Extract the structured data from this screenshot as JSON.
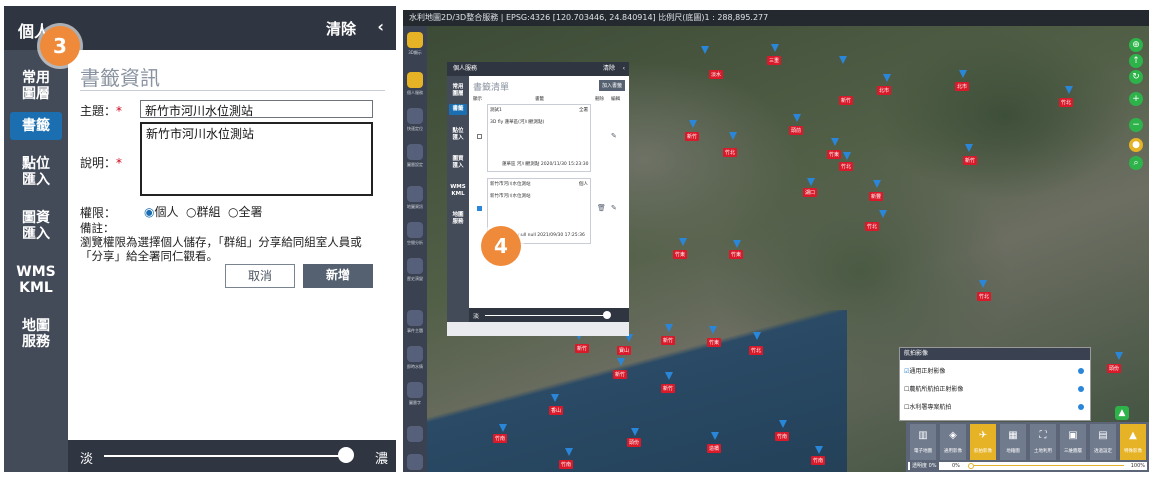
{
  "left": {
    "header": {
      "title": "個人",
      "clear": "清除",
      "chevron": "‹"
    },
    "sidebar": [
      {
        "label": "常用\n圖層"
      },
      {
        "label": "書籤"
      },
      {
        "label": "點位\n匯入"
      },
      {
        "label": "圖資\n匯入"
      },
      {
        "label": "WMS\nKML"
      },
      {
        "label": "地圖\n服務"
      }
    ],
    "form": {
      "heading": "書籤資訊",
      "subject_label": "主題：",
      "required_mark": "*",
      "subject_value": "新竹市河川水位測站",
      "desc_label": "說明：",
      "desc_value": "新竹市河川水位測站",
      "perm_label": "權限：",
      "perm_options": [
        "個人",
        "群組",
        "全署"
      ],
      "note_title": "備註：",
      "note_line1": "瀏覽權限為選擇個人儲存，「群組」分享給同組室人員或",
      "note_line2": "「分享」給全署同仁觀看。",
      "cancel": "取消",
      "add": "新增"
    },
    "footer": {
      "faint": "淡",
      "dense": "濃"
    },
    "badge": "3"
  },
  "right": {
    "topbar": "水利地圖2D/3D整合服務 | EPSG:4326 [120.703446, 24.840914] 比例尺(底圖)1 : 288,895.277",
    "sidebar_labels": [
      "3D顯示",
      "",
      "個人服務",
      "快速定位",
      "圖層設定",
      "地圖資訊",
      "空間分析",
      "歷史演變",
      "事件主題",
      "即時水情",
      "圖層字",
      ""
    ],
    "panel": {
      "title": "個人服務",
      "clear": "清除",
      "tabs": [
        "常用\n圖層",
        "書籤",
        "點位\n匯入",
        "圖資\n匯入",
        "WMS\nKML",
        "地圖\n服務"
      ],
      "heading": "書籤清單",
      "add_btn": "加入書籤",
      "cols": [
        "顯示",
        "書籤",
        "刪除",
        "編輯"
      ],
      "group_label": "測試1",
      "group_scope": "全署",
      "item1": "3D fly 蓮華區(河川觀測點)",
      "item1_meta": "蓮華區 河川觀測點 2020/11/30 15:23:30",
      "item2": "新竹市河川水位測站",
      "item2_scope": "個人",
      "item2_sub": "新竹市河川水位測站",
      "item2_meta": "null null 2021/09/30 17:25:36",
      "footer": "淡"
    },
    "badge": "4",
    "aerial": {
      "title": "航拍影像",
      "rows": [
        "通用正射影像",
        "農航所航拍正射影像",
        "水利署專案航拍"
      ]
    },
    "toolbar": {
      "buttons": [
        "電子地圖",
        "通用影像",
        "航拍影像",
        "地籍圖",
        "土地利用",
        "三維圖層",
        "透過設定",
        "特殊影像"
      ],
      "slider": "透明度 0%",
      "slider_start": "0%",
      "slider_end": "100%"
    },
    "map_labels": [
      "淡水",
      "三重",
      "新竹",
      "北市",
      "北市",
      "竹北",
      "新竹",
      "竹北",
      "頭前",
      "竹東",
      "竹北",
      "新豐",
      "湖口",
      "新竹",
      "竹北",
      "竹東",
      "竹東",
      "竹北",
      "新竹",
      "寶山",
      "新竹",
      "竹東",
      "竹北",
      "新竹",
      "香山",
      "新竹",
      "竹南",
      "竹南",
      "頭份",
      "造橋",
      "竹南",
      "竹南",
      "頭份"
    ]
  }
}
